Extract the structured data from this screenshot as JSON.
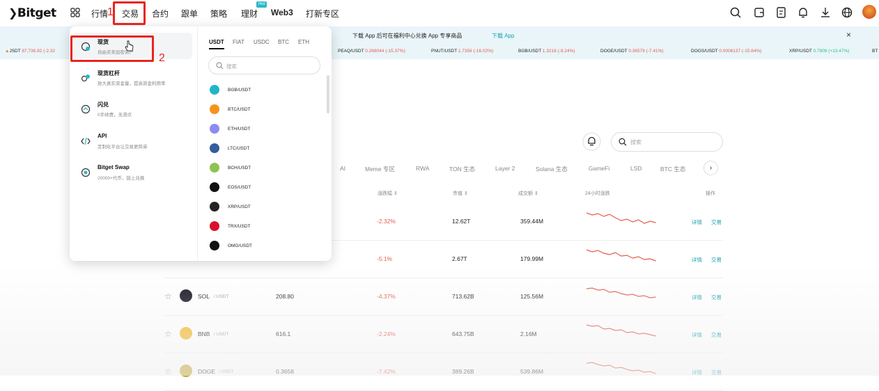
{
  "topnav": {
    "logo": "Bitget",
    "items": [
      "行情",
      "交易",
      "合约",
      "跟单",
      "策略",
      "理财",
      "Web3",
      "打新专区"
    ],
    "hot_badge": "Hot",
    "icons": [
      "search-icon",
      "wallet-icon",
      "orders-icon",
      "bell-icon",
      "download-icon",
      "globe-icon",
      "avatar"
    ]
  },
  "annotations": {
    "step1": "1",
    "step2": "2",
    "color": "#e8251f"
  },
  "banner": {
    "text": "下载 App 后可在福利中心兑换 App 专享商品",
    "link": "下载 App",
    "close": "×"
  },
  "ticker": [
    {
      "sym": "JSDT",
      "price": "87,736.82",
      "chg": "(-2.32",
      "dir": "neg"
    },
    {
      "sym": "PEAQ/USDT",
      "price": "0.268044",
      "chg": "(-15.37%)",
      "dir": "neg"
    },
    {
      "sym": "PNUT/USDT",
      "price": "1.7356",
      "chg": "(-16.02%)",
      "dir": "neg"
    },
    {
      "sym": "BGB/USDT",
      "price": "1.3216",
      "chg": "(-9.24%)",
      "dir": "neg"
    },
    {
      "sym": "DOGE/USDT",
      "price": "0.36579",
      "chg": "(-7.41%)",
      "dir": "neg"
    },
    {
      "sym": "DOGS/USDT",
      "price": "0.0006137",
      "chg": "(-15.64%)",
      "dir": "neg"
    },
    {
      "sym": "XRP/USDT",
      "price": "0.7909",
      "chg": "(+13.47%)",
      "dir": "pos"
    },
    {
      "sym": "BT",
      "price": "",
      "chg": "",
      "dir": "neg"
    }
  ],
  "dropdown": {
    "menu": [
      {
        "title": "现货",
        "sub": "自由买卖加密资产",
        "icon": "spot-icon"
      },
      {
        "title": "现货杠杆",
        "sub": "放大真实资金量，提高资金利用率",
        "icon": "margin-icon"
      },
      {
        "title": "闪兑",
        "sub": "0手续费，无滑点",
        "icon": "convert-icon"
      },
      {
        "title": "API",
        "sub": "定制化平台让交易更简单",
        "icon": "api-icon"
      },
      {
        "title": "Bitget Swap",
        "sub": "20000+代币，链上兑换",
        "icon": "swap-icon"
      }
    ],
    "quote_tabs": [
      "USDT",
      "FIAT",
      "USDC",
      "BTC",
      "ETH"
    ],
    "search_placeholder": "搜索",
    "pairs": [
      {
        "name": "BGB/USDT",
        "color": "#1fb5c7"
      },
      {
        "name": "BTC/USDT",
        "color": "#f7931a"
      },
      {
        "name": "ETH/USDT",
        "color": "#8c8cf0"
      },
      {
        "name": "LTC/USDT",
        "color": "#345d9d"
      },
      {
        "name": "BCH/USDT",
        "color": "#8dc351"
      },
      {
        "name": "EOS/USDT",
        "color": "#111111"
      },
      {
        "name": "XRP/USDT",
        "color": "#222222"
      },
      {
        "name": "TRX/USDT",
        "color": "#d9122c"
      },
      {
        "name": "OMG/USDT",
        "color": "#101010"
      }
    ]
  },
  "market": {
    "search_placeholder": "搜索",
    "categories": [
      "AI",
      "Meme 专区",
      "RWA",
      "TON 生态",
      "Layer 2",
      "Solana 生态",
      "GameFi",
      "LSD",
      "BTC 生态"
    ],
    "headers": [
      "涨跌幅",
      "市值",
      "成交额",
      "24小时涨跌",
      "操作"
    ],
    "rows": [
      {
        "coin": "",
        "quote": "",
        "price": "",
        "change": "-2.32%",
        "mcap": "12.62T",
        "volume": "359.44M"
      },
      {
        "coin": "",
        "quote": "",
        "price": "",
        "change": "-5.1%",
        "mcap": "2.67T",
        "volume": "179.99M"
      },
      {
        "coin": "SOL",
        "quote": "/ USDT",
        "price": "208.80",
        "change": "-4.37%",
        "mcap": "713.62B",
        "volume": "125.56M"
      },
      {
        "coin": "BNB",
        "quote": "/ USDT",
        "price": "616.1",
        "change": "-2.24%",
        "mcap": "643.75B",
        "volume": "2.16M"
      },
      {
        "coin": "DOGE",
        "quote": "/ USDT",
        "price": "0.3658",
        "change": "-7.42%",
        "mcap": "389.26B",
        "volume": "539.86M"
      }
    ],
    "detail_label": "详情",
    "trade_label": "交易",
    "star": "☆"
  }
}
